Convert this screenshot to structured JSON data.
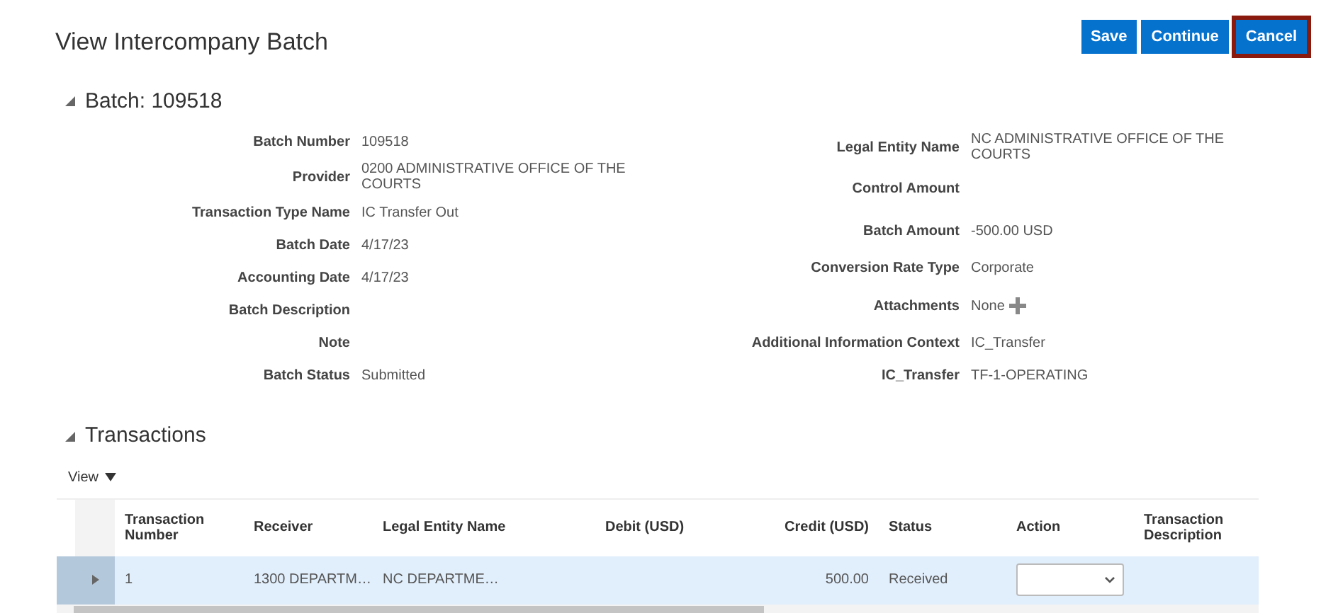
{
  "page": {
    "title": "View Intercompany Batch"
  },
  "buttons": [
    {
      "label": "Save",
      "highlighted": false
    },
    {
      "label": "Continue",
      "highlighted": false
    },
    {
      "label": "Cancel",
      "highlighted": true
    }
  ],
  "batch": {
    "header": "Batch: 109518",
    "expanded": true,
    "left_fields": [
      {
        "label": "Batch Number",
        "value": "109518"
      },
      {
        "label": "Provider",
        "value": "0200 ADMINISTRATIVE OFFICE OF THE COURTS"
      },
      {
        "label": "Transaction Type Name",
        "value": "IC Transfer Out"
      },
      {
        "label": "Batch Date",
        "value": "4/17/23"
      },
      {
        "label": "Accounting Date",
        "value": "4/17/23"
      },
      {
        "label": "Batch Description"
      },
      {
        "label": "Note"
      },
      {
        "label": "Batch Status",
        "value": "Submitted"
      }
    ],
    "right_fields": [
      {
        "label": "Legal Entity Name",
        "value": "NC ADMINISTRATIVE OFFICE OF THE COURTS"
      },
      {
        "label": "Control Amount"
      },
      {
        "label": "Batch Amount",
        "value": "-500.00 USD"
      },
      {
        "label": "Conversion Rate Type",
        "value": "Corporate"
      },
      {
        "label": "Attachments",
        "value": "None",
        "kind": "attach"
      },
      {
        "label": "Additional Information Context",
        "value": "IC_Transfer"
      },
      {
        "label": "IC_Transfer",
        "value": "TF-1-OPERATING"
      }
    ]
  },
  "transactions": {
    "header": "Transactions",
    "expanded": true,
    "view_menu": "View",
    "columns": [
      "Transaction Number",
      "Receiver",
      "Legal Entity Name",
      "Debit (USD)",
      "Credit (USD)",
      "Status",
      "Action",
      "Transaction Description"
    ],
    "rows": [
      {
        "selected": true,
        "cells": [
          "1",
          "1300 DEPARTM…",
          "NC DEPARTME…",
          "",
          "500.00",
          "Received"
        ]
      }
    ]
  }
}
